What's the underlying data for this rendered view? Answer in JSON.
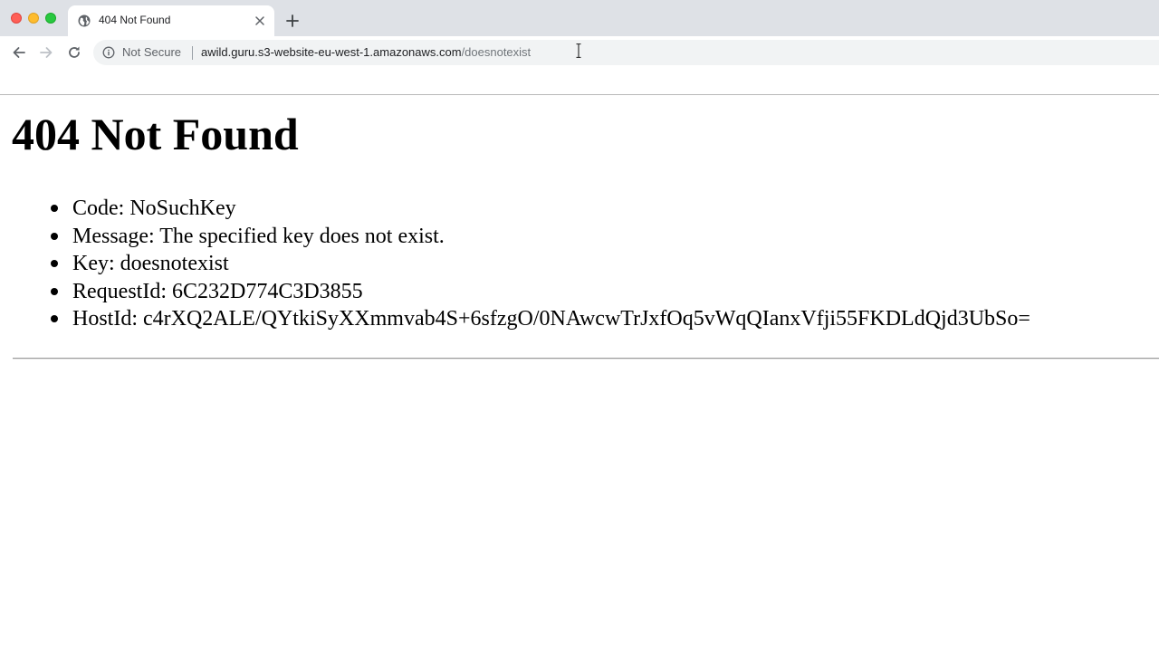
{
  "browser": {
    "tab": {
      "title": "404 Not Found",
      "favicon": "globe-icon",
      "close_icon": "close-icon"
    },
    "new_tab_icon": "plus-icon",
    "nav": {
      "back_icon": "back-arrow-icon",
      "forward_icon": "forward-arrow-icon",
      "reload_icon": "reload-icon"
    },
    "address_bar": {
      "security_icon": "info-icon",
      "security_label": "Not Secure",
      "url_host": "awild.guru.s3-website-eu-west-1.amazonaws.com",
      "url_path": "/doesnotexist"
    }
  },
  "page": {
    "heading": "404 Not Found",
    "details": [
      {
        "text": "Code: NoSuchKey"
      },
      {
        "text": "Message: The specified key does not exist."
      },
      {
        "text": "Key: doesnotexist"
      },
      {
        "text": "RequestId: 6C232D774C3D3855"
      },
      {
        "text": "HostId: c4rXQ2ALE/QYtkiSyXXmmvab4S+6sfzgO/0NAwcwTrJxfOq5vWqQIanxVfji55FKDLdQjd3UbSo="
      }
    ]
  },
  "colors": {
    "tabstrip_bg": "#dee1e6",
    "omnibox_bg": "#f1f3f4",
    "close_red": "#ff5f57",
    "minimize_yellow": "#febc2e",
    "maximize_green": "#28c840"
  }
}
